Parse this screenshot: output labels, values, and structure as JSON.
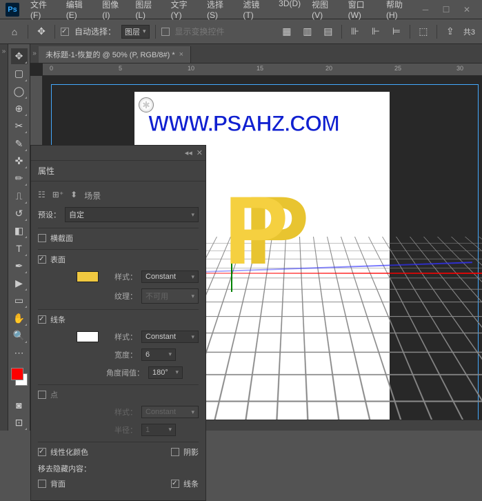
{
  "menubar": {
    "items": [
      "文件(F)",
      "编辑(E)",
      "图像(I)",
      "图层(L)",
      "文字(Y)",
      "选择(S)",
      "滤镜(T)",
      "3D(D)",
      "视图(V)",
      "窗口(W)",
      "帮助(H)"
    ]
  },
  "optionsbar": {
    "auto_select_label": "自动选择：",
    "auto_select_target": "图层",
    "show_transform": "显示变换控件"
  },
  "tab": {
    "title": "未标题-1-恢复的 @ 50% (P, RGB/8#) *"
  },
  "ruler": {
    "marks": [
      "0",
      "5",
      "10",
      "15",
      "20",
      "25",
      "30"
    ]
  },
  "canvas": {
    "watermark": "WWW.PSAHZ.COM",
    "letter": "P"
  },
  "panel": {
    "title": "属性",
    "scene_label": "场景",
    "preset_label": "预设：",
    "preset_value": "自定",
    "cross_section": "横截面",
    "surface": "表面",
    "style_label": "样式：",
    "surface_style": "Constant",
    "texture_label": "纹理：",
    "texture_value": "不可用",
    "lines": "线条",
    "lines_style": "Constant",
    "width_label": "宽度：",
    "width_value": "6",
    "angle_label": "角度阈值：",
    "angle_value": "180°",
    "points": "点",
    "points_style": "Constant",
    "radius_label": "半径：",
    "radius_value": "1",
    "linearize": "线性化颜色",
    "remove_hidden": "移去隐藏内容：",
    "shadow": "阴影",
    "backface": "背面",
    "lines2": "线条",
    "surface_color": "#f0c840",
    "lines_color": "#ffffff"
  },
  "swatch": {
    "fg": "#ff0000",
    "bg": "#ffffff"
  },
  "right_label": "共3"
}
